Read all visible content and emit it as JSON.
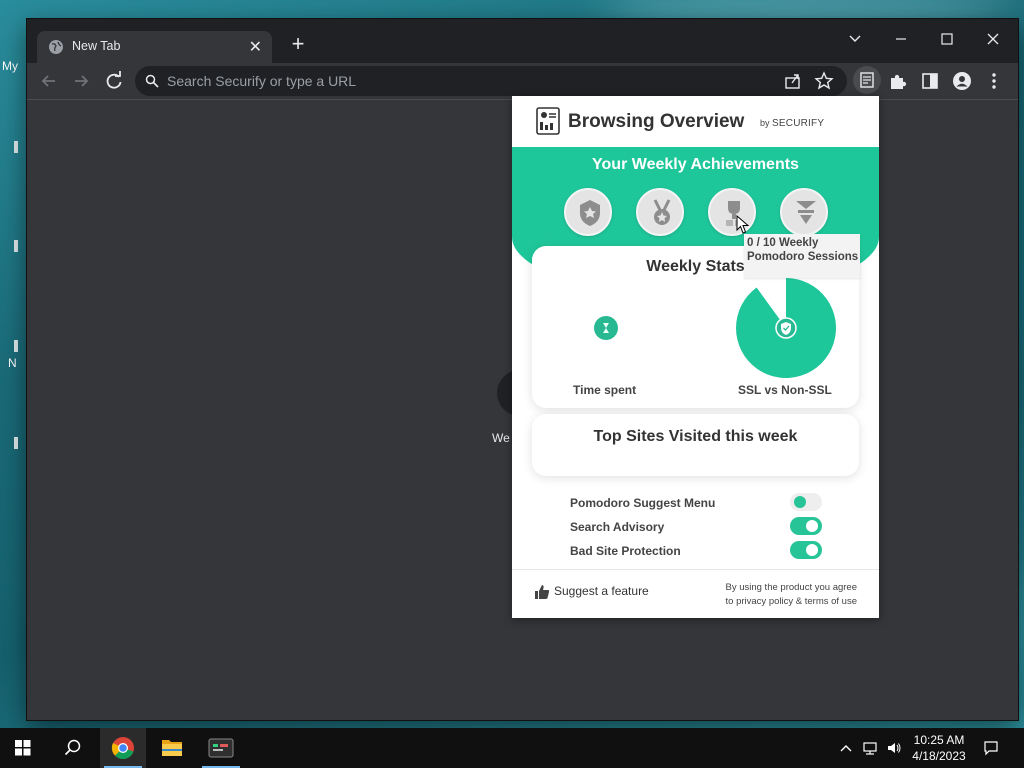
{
  "desktop": {
    "left_labels": [
      "My",
      "N"
    ],
    "ghost_label": "We"
  },
  "browser": {
    "tab_title": "New Tab",
    "omnibox_placeholder": "Search Securify or type a URL"
  },
  "popup": {
    "title": "Browsing Overview",
    "by": "by",
    "brand": "SECURIFY",
    "achievements_title": "Your Weekly Achievements",
    "badges": [
      "shield-badge-icon",
      "medal-badge-icon",
      "trophy-badge-icon",
      "podium-badge-icon"
    ],
    "tooltip": "0 / 10 Weekly Pomodoro Sessions",
    "weekly_stats_title": "Weekly Stats",
    "time_spent_label": "Time spent",
    "ssl_label": "SSL vs Non-SSL",
    "ssl_share": 0.9,
    "top_sites_title": "Top Sites Visited this week",
    "toggles": [
      {
        "label": "Pomodoro Suggest Menu",
        "on": false
      },
      {
        "label": "Search Advisory",
        "on": true
      },
      {
        "label": "Bad Site Protection",
        "on": true
      }
    ],
    "suggest_label": "Suggest a feature",
    "legal_line1": "By using the product you agree",
    "legal_line2": "to privacy policy & terms of use"
  },
  "taskbar": {
    "time": "10:25 AM",
    "date": "4/18/2023"
  },
  "colors": {
    "accent": "#1ec79a",
    "chrome_dark": "#202124",
    "chrome_mid": "#35363a"
  }
}
